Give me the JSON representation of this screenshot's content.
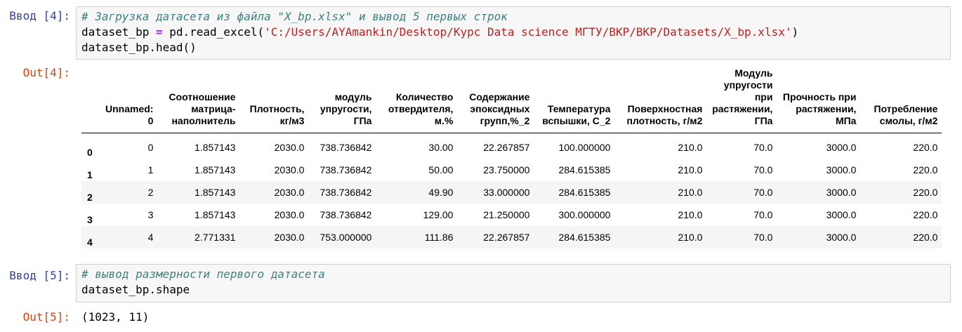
{
  "cell4": {
    "in_prompt": "Ввод [4]:",
    "out_prompt": "Out[4]:",
    "code": {
      "comment": "# Загрузка датасета из файла \"X_bp.xlsx\" и вывод 5 первых строк",
      "line2_var": "dataset_bp ",
      "line2_op": "=",
      "line2_call": " pd.read_excel(",
      "line2_str": "'C:/Users/AYAmankin/Desktop/Курс Data science МГТУ/ВКР/ВКР/Datasets/X_bp.xlsx'",
      "line2_end": ")",
      "line3": "dataset_bp.head()"
    },
    "table": {
      "columns": [
        "",
        "Unnamed: 0",
        "Соотношение матрица-наполнитель",
        "Плотность, кг/м3",
        "модуль упругости, ГПа",
        "Количество отвердителя, м.%",
        "Содержание эпоксидных групп,%_2",
        "Температура вспышки, С_2",
        "Поверхностная плотность, г/м2",
        "Модуль упругости при растяжении, ГПа",
        "Прочность при растяжении, МПа",
        "Потребление смолы, г/м2"
      ],
      "rows": [
        [
          "0",
          "0",
          "1.857143",
          "2030.0",
          "738.736842",
          "30.00",
          "22.267857",
          "100.000000",
          "210.0",
          "70.0",
          "3000.0",
          "220.0"
        ],
        [
          "1",
          "1",
          "1.857143",
          "2030.0",
          "738.736842",
          "50.00",
          "23.750000",
          "284.615385",
          "210.0",
          "70.0",
          "3000.0",
          "220.0"
        ],
        [
          "2",
          "2",
          "1.857143",
          "2030.0",
          "738.736842",
          "49.90",
          "33.000000",
          "284.615385",
          "210.0",
          "70.0",
          "3000.0",
          "220.0"
        ],
        [
          "3",
          "3",
          "1.857143",
          "2030.0",
          "738.736842",
          "129.00",
          "21.250000",
          "300.000000",
          "210.0",
          "70.0",
          "3000.0",
          "220.0"
        ],
        [
          "4",
          "4",
          "2.771331",
          "2030.0",
          "753.000000",
          "111.86",
          "22.267857",
          "284.615385",
          "210.0",
          "70.0",
          "3000.0",
          "220.0"
        ]
      ]
    }
  },
  "cell5": {
    "in_prompt": "Ввод [5]:",
    "out_prompt": "Out[5]:",
    "code": {
      "comment": "# вывод размерности первого датасета",
      "line2": "dataset_bp.shape"
    },
    "output": "(1023, 11)"
  }
}
